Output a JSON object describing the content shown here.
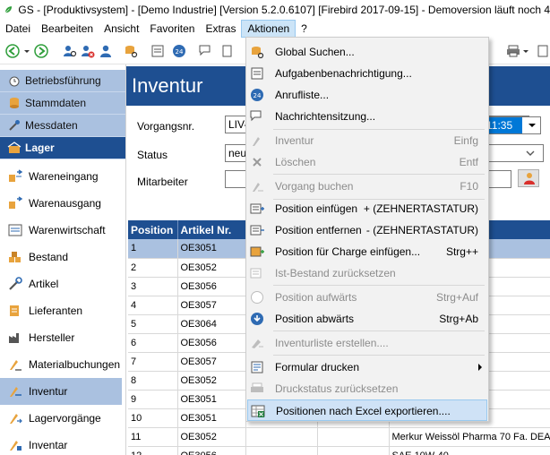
{
  "titlebar": {
    "text": "GS - [Produktivsystem] - [Demo Industrie]  [Version  5.2.0.6107]  [Firebird 2017-09-15] - Demoversion läuft noch 4"
  },
  "menubar": {
    "items": [
      {
        "label": "Datei"
      },
      {
        "label": "Bearbeiten"
      },
      {
        "label": "Ansicht"
      },
      {
        "label": "Favoriten"
      },
      {
        "label": "Extras"
      },
      {
        "label": "Aktionen"
      },
      {
        "label": "?"
      }
    ]
  },
  "sidebar": {
    "groups": [
      {
        "label": "Betriebsführung"
      },
      {
        "label": "Stammdaten"
      },
      {
        "label": "Messdaten"
      },
      {
        "label": "Lager"
      }
    ],
    "items": [
      {
        "label": "Wareneingang"
      },
      {
        "label": "Warenausgang"
      },
      {
        "label": "Warenwirtschaft"
      },
      {
        "label": "Bestand"
      },
      {
        "label": "Artikel"
      },
      {
        "label": "Lieferanten"
      },
      {
        "label": "Hersteller"
      },
      {
        "label": "Materialbuchungen"
      },
      {
        "label": "Inventur"
      },
      {
        "label": "Lagervorgänge"
      },
      {
        "label": "Inventar"
      }
    ]
  },
  "main": {
    "title": "Inventur",
    "form": {
      "vorgangsnr_label": "Vorgangsnr.",
      "vorgangsnr_value": "LIV-",
      "status_label": "Status",
      "status_value": "neu",
      "mitarbeiter_label": "Mitarbeiter",
      "time_value": "11:35"
    },
    "grid": {
      "columns": [
        "Position",
        "Artikel Nr.",
        "",
        "",
        ""
      ],
      "rows": [
        {
          "pos": "1",
          "art": "OE3051",
          "desc": ""
        },
        {
          "pos": "2",
          "art": "OE3052",
          "desc": ""
        },
        {
          "pos": "3",
          "art": "OE3056",
          "desc": ""
        },
        {
          "pos": "4",
          "art": "OE3057",
          "desc": ""
        },
        {
          "pos": "5",
          "art": "OE3064",
          "desc": ""
        },
        {
          "pos": "6",
          "art": "OE3056",
          "desc": ""
        },
        {
          "pos": "7",
          "art": "OE3057",
          "desc": ""
        },
        {
          "pos": "8",
          "art": "OE3052",
          "desc": ""
        },
        {
          "pos": "9",
          "art": "OE3051",
          "desc": ""
        },
        {
          "pos": "10",
          "art": "OE3051",
          "desc": ""
        },
        {
          "pos": "11",
          "art": "OE3052",
          "desc": "Merkur Weissöl Pharma 70 Fa. DEA"
        },
        {
          "pos": "12",
          "art": "OE3056",
          "desc": "SAE 10W-40"
        }
      ]
    }
  },
  "dropdown": {
    "items": [
      {
        "label": "Global Suchen...",
        "shortcut": ""
      },
      {
        "label": "Aufgabenbenachrichtigung...",
        "shortcut": ""
      },
      {
        "label": "Anrufliste...",
        "shortcut": ""
      },
      {
        "label": "Nachrichtensitzung...",
        "shortcut": ""
      },
      {
        "label": "Inventur",
        "shortcut": "Einfg"
      },
      {
        "label": "Löschen",
        "shortcut": "Entf"
      },
      {
        "label": "Vorgang buchen",
        "shortcut": "F10"
      },
      {
        "label": "Position einfügen",
        "shortcut": "+ (ZEHNERTASTATUR)"
      },
      {
        "label": "Position entfernen",
        "shortcut": "- (ZEHNERTASTATUR)"
      },
      {
        "label": "Position für Charge einfügen...",
        "shortcut": "Strg++"
      },
      {
        "label": "Ist-Bestand zurücksetzen",
        "shortcut": ""
      },
      {
        "label": "Position aufwärts",
        "shortcut": "Strg+Auf"
      },
      {
        "label": "Position abwärts",
        "shortcut": "Strg+Ab"
      },
      {
        "label": "Inventurliste erstellen....",
        "shortcut": ""
      },
      {
        "label": "Formular drucken",
        "shortcut": ""
      },
      {
        "label": "Druckstatus zurücksetzen",
        "shortcut": ""
      },
      {
        "label": "Positionen nach Excel exportieren....",
        "shortcut": ""
      }
    ]
  },
  "colors": {
    "header_blue": "#1e4f91",
    "nav_light_blue": "#aac1e0",
    "menu_highlight": "#cfe2f6",
    "time_selection": "#0078d7"
  }
}
